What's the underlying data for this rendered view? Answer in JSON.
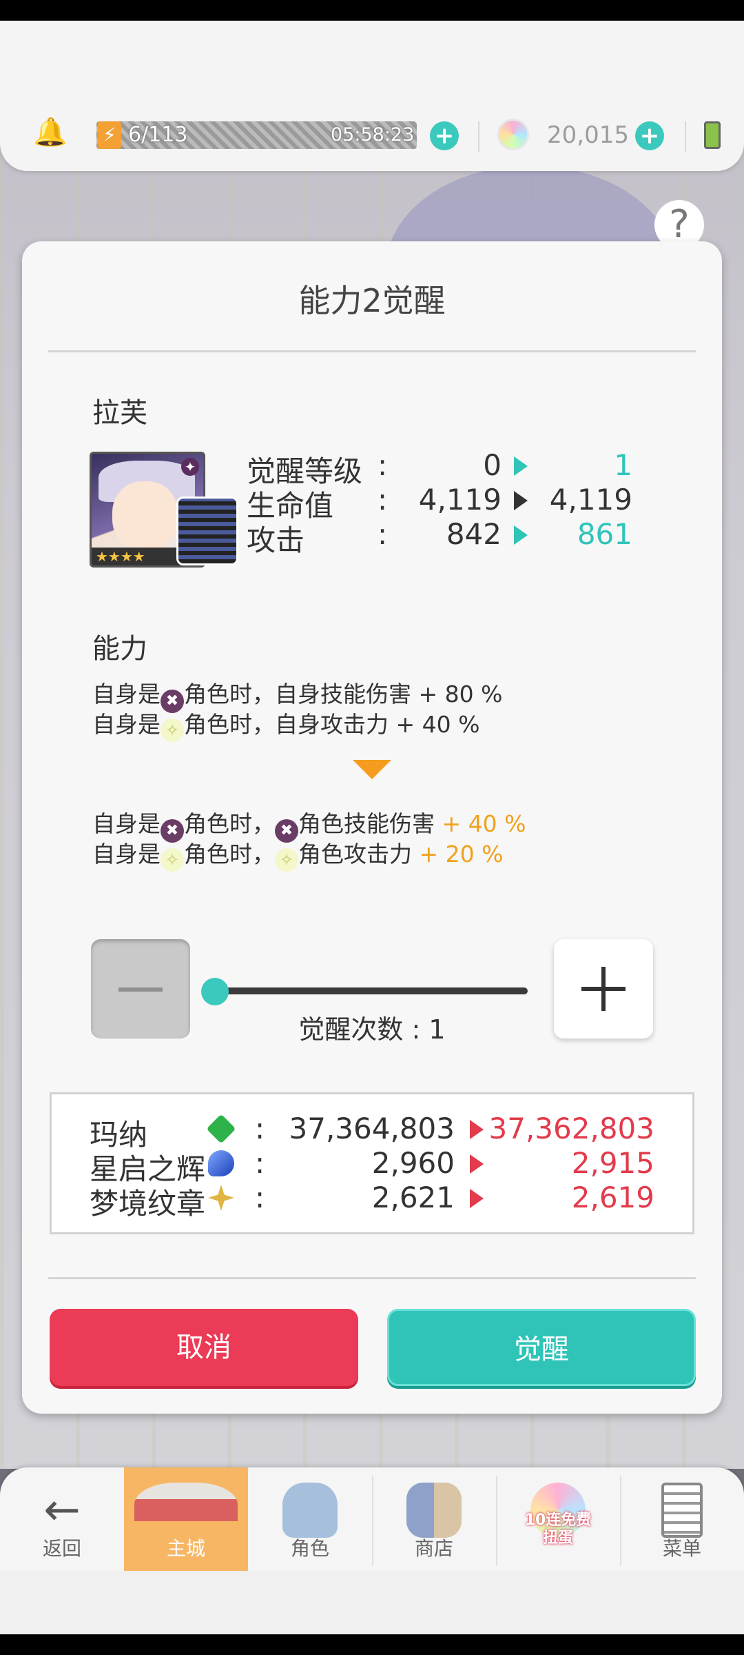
{
  "resources": {
    "stamina": "6/113",
    "stamina_timer": "05:58:23",
    "gems": "20,015"
  },
  "icons": {
    "bell": "bell-icon",
    "bolt": "lightning-icon",
    "plus": "plus-icon",
    "gem": "rainbow-gem-icon",
    "battery": "battery-icon",
    "help": "question-mark-icon"
  },
  "dialog": {
    "title": "能力2觉醒",
    "character_name": "拉芙",
    "stats": [
      {
        "label": "觉醒等级",
        "before": "0",
        "after": "1",
        "after_highlight": true
      },
      {
        "label": "生命值",
        "before": "4,119",
        "after": "4,119",
        "after_highlight": false
      },
      {
        "label": "攻击",
        "before": "842",
        "after": "861",
        "after_highlight": true
      }
    ],
    "ability_label": "能力",
    "current": {
      "line1_prefix": "自身是",
      "line1_mid": "角色时，自身技能伤害 + 80 %",
      "line2_prefix": "自身是",
      "line2_mid": "角色时，自身攻击力 + 40 %"
    },
    "next": {
      "line1_prefix": "自身是",
      "line1_mid": "角色时，",
      "line1_tail": "角色技能伤害",
      "line1_value": " + 40 %",
      "line2_prefix": "自身是",
      "line2_mid": "角色时，",
      "line2_tail": "角色攻击力",
      "line2_value": " + 20 %"
    },
    "awaken_count_label": "觉醒次数 : 1",
    "costs": [
      {
        "label": "玛纳",
        "icon": "green-gem-icon",
        "before": "37,364,803",
        "after": "37,362,803"
      },
      {
        "label": "星启之辉",
        "icon": "blue-flame-icon",
        "before": "2,960",
        "after": "2,915"
      },
      {
        "label": "梦境纹章",
        "icon": "gold-star-icon",
        "before": "2,621",
        "after": "2,619"
      }
    ],
    "cancel_label": "取消",
    "confirm_label": "觉醒",
    "colors": {
      "teal": "#30c4b8",
      "red": "#e23b4b",
      "orange": "#f0a11d"
    }
  },
  "nav": {
    "back": "返回",
    "main": "主城",
    "character": "角色",
    "shop": "商店",
    "gacha_badge_1": "10连免费",
    "gacha_badge_2": "扭蛋",
    "menu": "菜单"
  }
}
